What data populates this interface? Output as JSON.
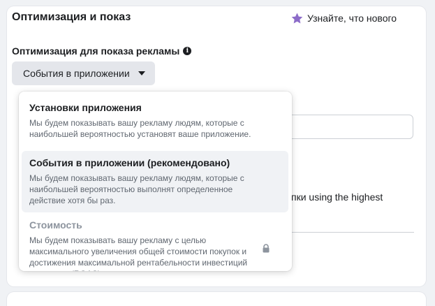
{
  "section": {
    "title": "Оптимизация и показ",
    "whats_new_label": "Узнайте, что нового"
  },
  "optimization": {
    "label": "Оптимизация для показа рекламы",
    "selected_value": "События в приложении"
  },
  "background": {
    "partial_text": "упки using the highest"
  },
  "menu": {
    "items": [
      {
        "title": "Установки приложения",
        "description": "Мы будем показывать вашу рекламу людям, которые с наибольшей вероятностью установят ваше приложение.",
        "state": "normal"
      },
      {
        "title": "События в приложении (рекомендовано)",
        "description": "Мы будем показывать вашу рекламу людям, которые с наибольшей вероятностью выполнят определенное действие хотя бы раз.",
        "state": "selected"
      },
      {
        "title": "Стоимость",
        "description": "Мы будем показывать вашу рекламу с целью максимального увеличения общей стоимости покупок и достижения максимальной рентабельности инвестиций в рекламу (ROAS).",
        "state": "disabled"
      }
    ]
  },
  "icons": {
    "star": "star-icon",
    "info": "info-icon",
    "caret": "caret-down-icon",
    "lock": "lock-icon"
  },
  "colors": {
    "star": "#8c6cc9",
    "selected_bg": "#f0f2f5",
    "button_bg": "#e4e6eb"
  }
}
